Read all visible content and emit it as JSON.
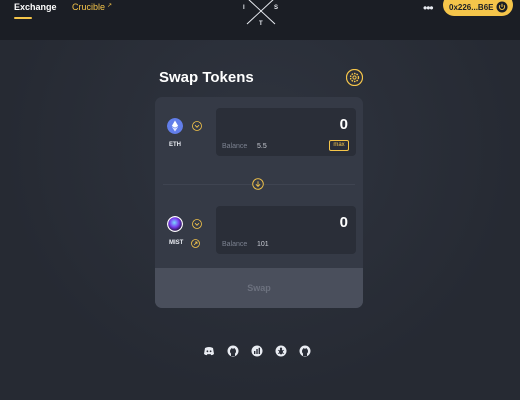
{
  "nav": {
    "tabs": [
      {
        "label": "Exchange",
        "active": true
      },
      {
        "label": "Crucible",
        "external": true
      }
    ]
  },
  "logo": {
    "letters": [
      "I",
      "S",
      "T"
    ]
  },
  "header": {
    "more_icon": "ellipsis-icon",
    "wallet": {
      "address": "0x226...B6E",
      "icon": "power-icon"
    }
  },
  "swap": {
    "title": "Swap Tokens",
    "settings_icon": "gear-icon",
    "from": {
      "symbol": "ETH",
      "amount": "0",
      "balance_label": "Balance",
      "balance": "5.5",
      "max_label": "max"
    },
    "to": {
      "symbol": "MIST",
      "amount": "0",
      "balance_label": "Balance",
      "balance": "101"
    },
    "direction_icon": "arrow-down-icon",
    "button_label": "Swap"
  },
  "footer": {
    "icons": [
      "discord-icon",
      "github-icon",
      "chart-icon",
      "bug-icon",
      "github-icon"
    ]
  },
  "colors": {
    "accent": "#f5c54a",
    "background": "#2a2e38",
    "header": "#1b1e25",
    "card": "#353a46"
  }
}
